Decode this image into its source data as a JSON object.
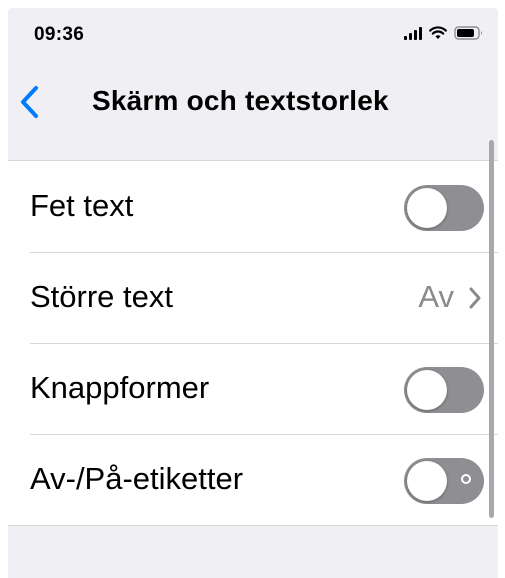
{
  "status_bar": {
    "time": "09:36",
    "icons": [
      "cellular-signal-icon",
      "wifi-icon",
      "battery-icon"
    ]
  },
  "nav": {
    "back_icon": "chevron-left-icon",
    "title": "Skärm och textstorlek"
  },
  "colors": {
    "accent": "#007aff",
    "toggle_off": "#8e8e93",
    "secondary_text": "#8a8a8e",
    "background": "#efeff4"
  },
  "settings": {
    "items": [
      {
        "label": "Fet text",
        "type": "toggle",
        "on": false
      },
      {
        "label": "Större text",
        "type": "disclosure",
        "value": "Av"
      },
      {
        "label": "Knappformer",
        "type": "toggle",
        "on": false
      },
      {
        "label": "Av-/På-etiketter",
        "type": "toggle",
        "on": false,
        "off_label_shown": true
      }
    ]
  }
}
